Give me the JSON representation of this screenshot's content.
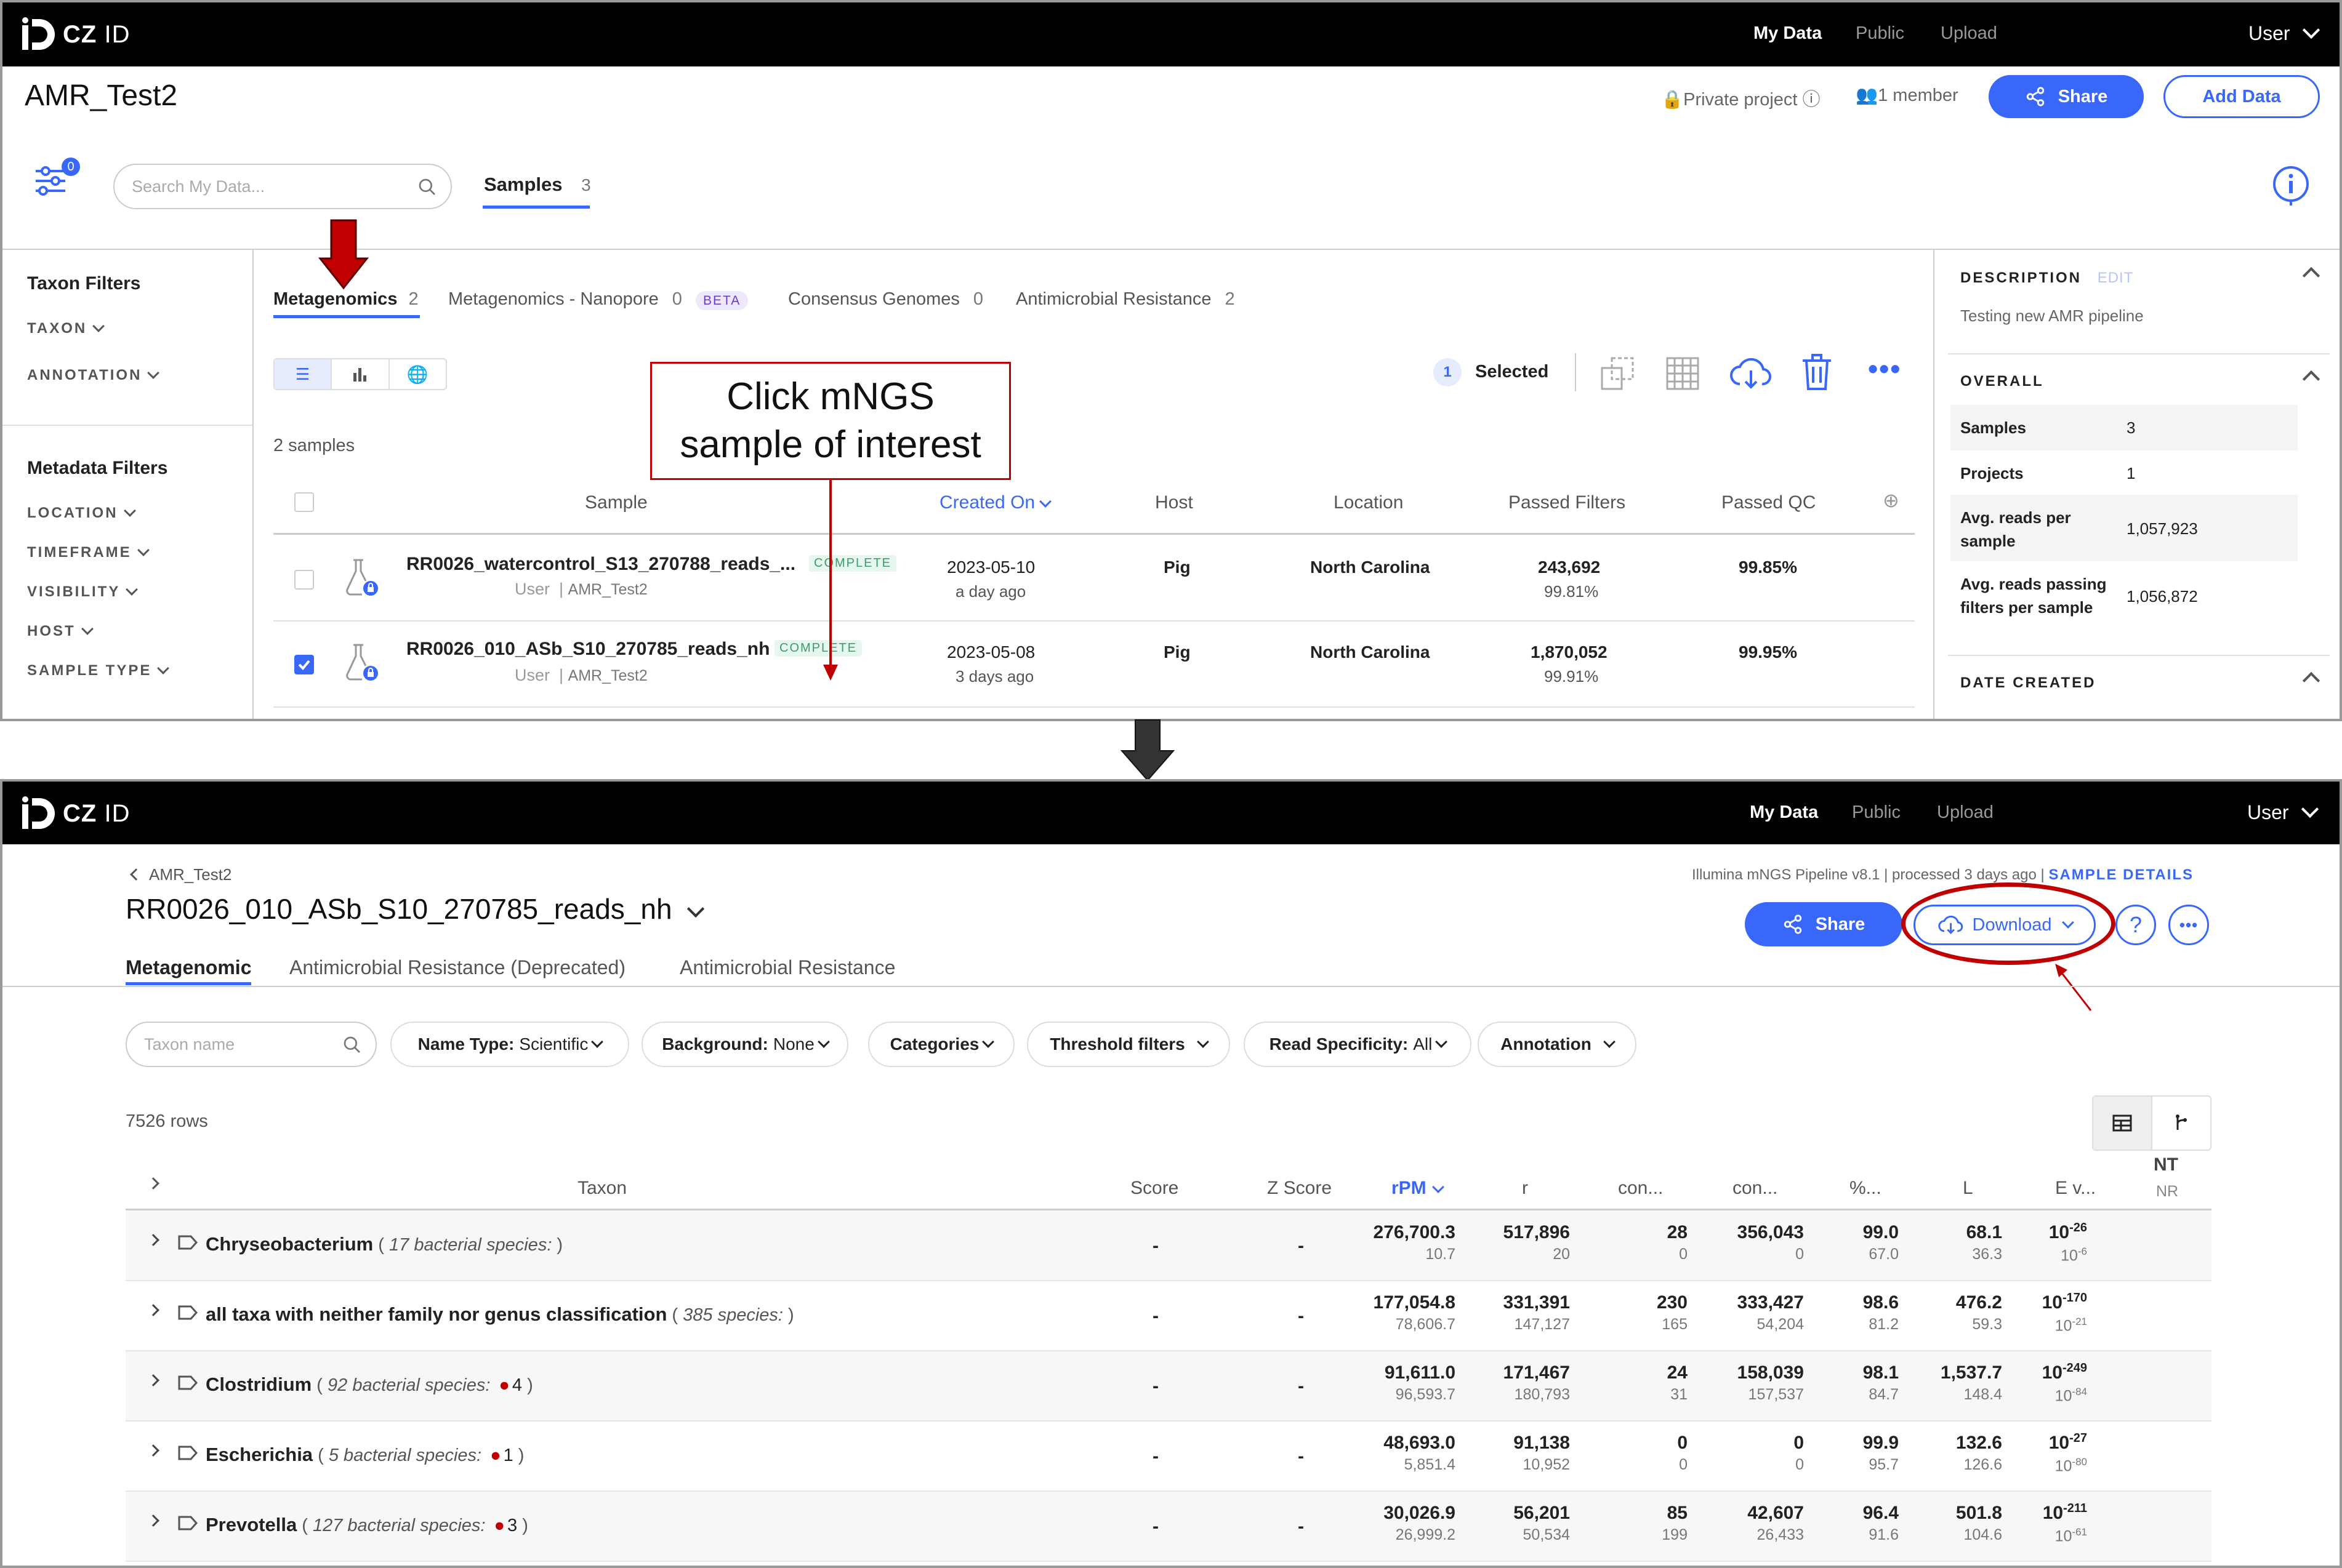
{
  "colors": {
    "accent": "#3867fa",
    "annotation_red": "#c00000",
    "arrow_dark": "#333333",
    "complete_green": "#3a9d6b",
    "beta_purple": "#6c3cc9"
  },
  "nav": {
    "logo_bold": "CZ",
    "logo_light": "ID",
    "my_data": "My Data",
    "public": "Public",
    "upload": "Upload",
    "user": "User"
  },
  "screen1": {
    "project_title": "AMR_Test2",
    "private_project": "Private project",
    "members": "1 member",
    "share": "Share",
    "add_data": "Add Data",
    "filter_count": "0",
    "search_placeholder": "Search My Data...",
    "samples_tab": "Samples",
    "samples_count": "3",
    "taxon_filters": "Taxon Filters",
    "taxon": "TAXON",
    "annotation": "ANNOTATION",
    "metadata_filters": "Metadata Filters",
    "metadata_items": [
      "LOCATION",
      "TIMEFRAME",
      "VISIBILITY",
      "HOST",
      "SAMPLE TYPE"
    ],
    "workflow_tabs": [
      {
        "label": "Metagenomics",
        "count": "2"
      },
      {
        "label": "Metagenomics - Nanopore",
        "count": "0",
        "badge": "BETA"
      },
      {
        "label": "Consensus Genomes",
        "count": "0"
      },
      {
        "label": "Antimicrobial Resistance",
        "count": "2"
      }
    ],
    "selected_count": "1",
    "selected_label": "Selected",
    "sample_count_text": "2 samples",
    "columns": [
      "Sample",
      "Created On",
      "Host",
      "Location",
      "Passed Filters",
      "Passed QC"
    ],
    "rows": [
      {
        "name": "RR0026_watercontrol_S13_270788_reads_...",
        "status": "COMPLETE",
        "user": "User",
        "project": "AMR_Test2",
        "date": "2023-05-10",
        "ago": "a day ago",
        "host": "Pig",
        "location": "North Carolina",
        "pf": "243,692",
        "pf_pct": "99.81%",
        "qc": "99.85%",
        "checked": false
      },
      {
        "name": "RR0026_010_ASb_S10_270785_reads_nh",
        "status": "COMPLETE",
        "user": "User",
        "project": "AMR_Test2",
        "date": "2023-05-08",
        "ago": "3 days ago",
        "host": "Pig",
        "location": "North Carolina",
        "pf": "1,870,052",
        "pf_pct": "99.91%",
        "qc": "99.95%",
        "checked": true
      }
    ],
    "callout": [
      "Click mNGS",
      "sample of interest"
    ],
    "description_header": "DESCRIPTION",
    "edit": "Edit",
    "description": "Testing new AMR pipeline",
    "overall_header": "OVERALL",
    "overall": [
      {
        "label": "Samples",
        "value": "3"
      },
      {
        "label": "Projects",
        "value": "1"
      },
      {
        "label": "Avg. reads per sample",
        "value": "1,057,923"
      },
      {
        "label": "Avg. reads passing filters per sample",
        "value": "1,056,872"
      }
    ],
    "date_created": "DATE CREATED"
  },
  "screen2": {
    "breadcrumb": "AMR_Test2",
    "sample_title": "RR0026_010_ASb_S10_270785_reads_nh",
    "pipeline_info": "Illumina mNGS Pipeline v8.1 | processed 3 days ago |",
    "sample_details": "SAMPLE DETAILS",
    "share": "Share",
    "download": "Download",
    "help": "?",
    "tabs": [
      "Metagenomic",
      "Antimicrobial Resistance (Deprecated)",
      "Antimicrobial Resistance"
    ],
    "taxon_placeholder": "Taxon name",
    "filters": [
      {
        "bold": "Name Type:",
        "light": "Scientific"
      },
      {
        "bold": "Background:",
        "light": "None"
      },
      {
        "bold": "Categories",
        "light": ""
      },
      {
        "bold": "Threshold filters",
        "light": ""
      },
      {
        "bold": "Read Specificity:",
        "light": "All"
      },
      {
        "bold": "Annotation",
        "light": ""
      }
    ],
    "rows_count": "7526 rows",
    "columns": [
      "Taxon",
      "Score",
      "Z Score",
      "rPM",
      "r",
      "con...",
      "con...",
      "%...",
      "L",
      "E v..."
    ],
    "nt": "NT",
    "nr": "NR",
    "table": [
      {
        "name": "Chryseobacterium",
        "species": "17 bacterial species:",
        "dot": "",
        "score": "-",
        "z": "-",
        "rpm": [
          "276,700.3",
          "10.7"
        ],
        "r": [
          "517,896",
          "20"
        ],
        "c1": [
          "28",
          "0"
        ],
        "c2": [
          "356,043",
          "0"
        ],
        "pct": [
          "99.0",
          "67.0"
        ],
        "l": [
          "68.1",
          "36.3"
        ],
        "ev": [
          "-26",
          "-6"
        ]
      },
      {
        "name": "all taxa with neither family nor genus classification",
        "species": "385 species:",
        "dot": "",
        "score": "-",
        "z": "-",
        "rpm": [
          "177,054.8",
          "78,606.7"
        ],
        "r": [
          "331,391",
          "147,127"
        ],
        "c1": [
          "230",
          "165"
        ],
        "c2": [
          "333,427",
          "54,204"
        ],
        "pct": [
          "98.6",
          "81.2"
        ],
        "l": [
          "476.2",
          "59.3"
        ],
        "ev": [
          "-170",
          "-21"
        ]
      },
      {
        "name": "Clostridium",
        "species": "92 bacterial species:",
        "dot": "4",
        "score": "-",
        "z": "-",
        "rpm": [
          "91,611.0",
          "96,593.7"
        ],
        "r": [
          "171,467",
          "180,793"
        ],
        "c1": [
          "24",
          "31"
        ],
        "c2": [
          "158,039",
          "157,537"
        ],
        "pct": [
          "98.1",
          "84.7"
        ],
        "l": [
          "1,537.7",
          "148.4"
        ],
        "ev": [
          "-249",
          "-84"
        ]
      },
      {
        "name": "Escherichia",
        "species": "5 bacterial species:",
        "dot": "1",
        "score": "-",
        "z": "-",
        "rpm": [
          "48,693.0",
          "5,851.4"
        ],
        "r": [
          "91,138",
          "10,952"
        ],
        "c1": [
          "0",
          "0"
        ],
        "c2": [
          "0",
          "0"
        ],
        "pct": [
          "99.9",
          "95.7"
        ],
        "l": [
          "132.6",
          "126.6"
        ],
        "ev": [
          "-27",
          "-80"
        ]
      },
      {
        "name": "Prevotella",
        "species": "127 bacterial species:",
        "dot": "3",
        "score": "-",
        "z": "-",
        "rpm": [
          "30,026.9",
          "26,999.2"
        ],
        "r": [
          "56,201",
          "50,534"
        ],
        "c1": [
          "85",
          "199"
        ],
        "c2": [
          "42,607",
          "26,433"
        ],
        "pct": [
          "96.4",
          "91.6"
        ],
        "l": [
          "501.8",
          "104.6"
        ],
        "ev": [
          "-211",
          "-61"
        ]
      }
    ],
    "ev_base": "10"
  }
}
